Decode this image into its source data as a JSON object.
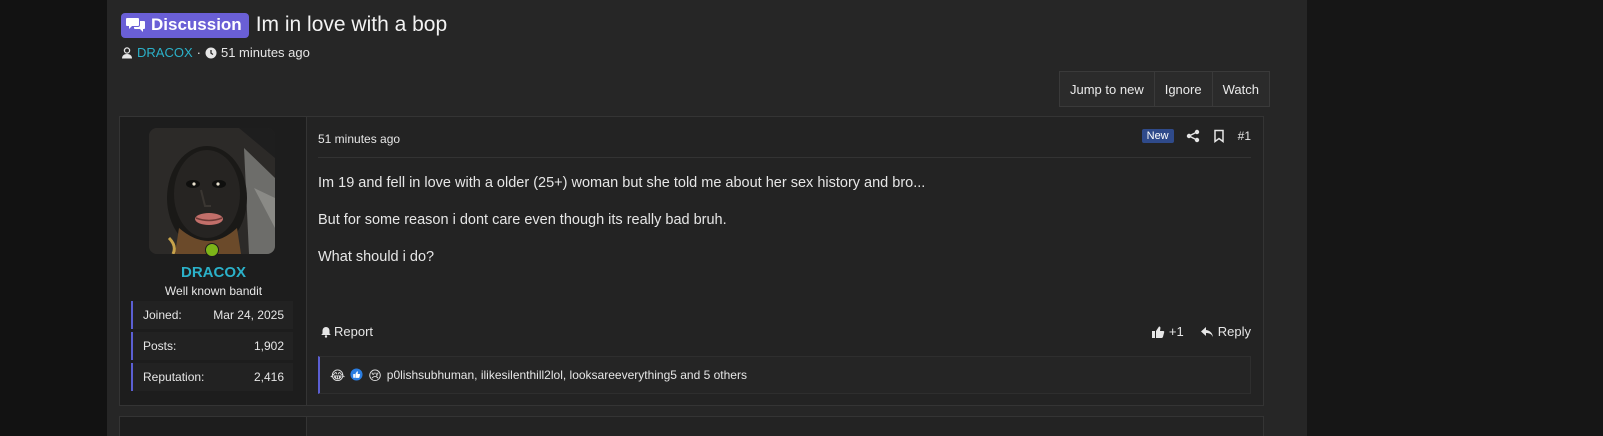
{
  "thread": {
    "prefix": "Discussion",
    "title": "Im in love with a bop",
    "author": "DRACOX",
    "separator": "·",
    "time": "51 minutes ago"
  },
  "actions": {
    "jump_to_new": "Jump to new",
    "ignore": "Ignore",
    "watch": "Watch"
  },
  "post": {
    "time": "51 minutes ago",
    "new_badge": "New",
    "number": "#1",
    "paragraphs": [
      "Im 19 and fell in love with a older (25+) woman but she told me about her sex history and bro...",
      "But for some reason i dont care even though its really bad bruh.",
      "What should i do?"
    ],
    "report_label": "Report",
    "like_count": "+1",
    "reply_label": "Reply",
    "reactions_text": "p0lishsubhuman, ilikesilenthill2lol, looksareeverything5 and 5 others"
  },
  "user": {
    "name": "DRACOX",
    "title": "Well known bandit",
    "stats": [
      {
        "label": "Joined:",
        "value": "Mar 24, 2025"
      },
      {
        "label": "Posts:",
        "value": "1,902"
      },
      {
        "label": "Reputation:",
        "value": "2,416"
      }
    ]
  },
  "icons": {
    "prefix": "comments-icon",
    "author": "user-icon",
    "time": "clock-icon",
    "share": "share-icon",
    "bookmark": "bookmark-icon",
    "report": "bell-icon",
    "like": "thumbs-up-icon",
    "reply": "reply-icon"
  },
  "colors": {
    "accent": "#6a5fd6",
    "link": "#2bb1c9",
    "online": "#7cb518",
    "stat_border": "#5b5fd3"
  }
}
